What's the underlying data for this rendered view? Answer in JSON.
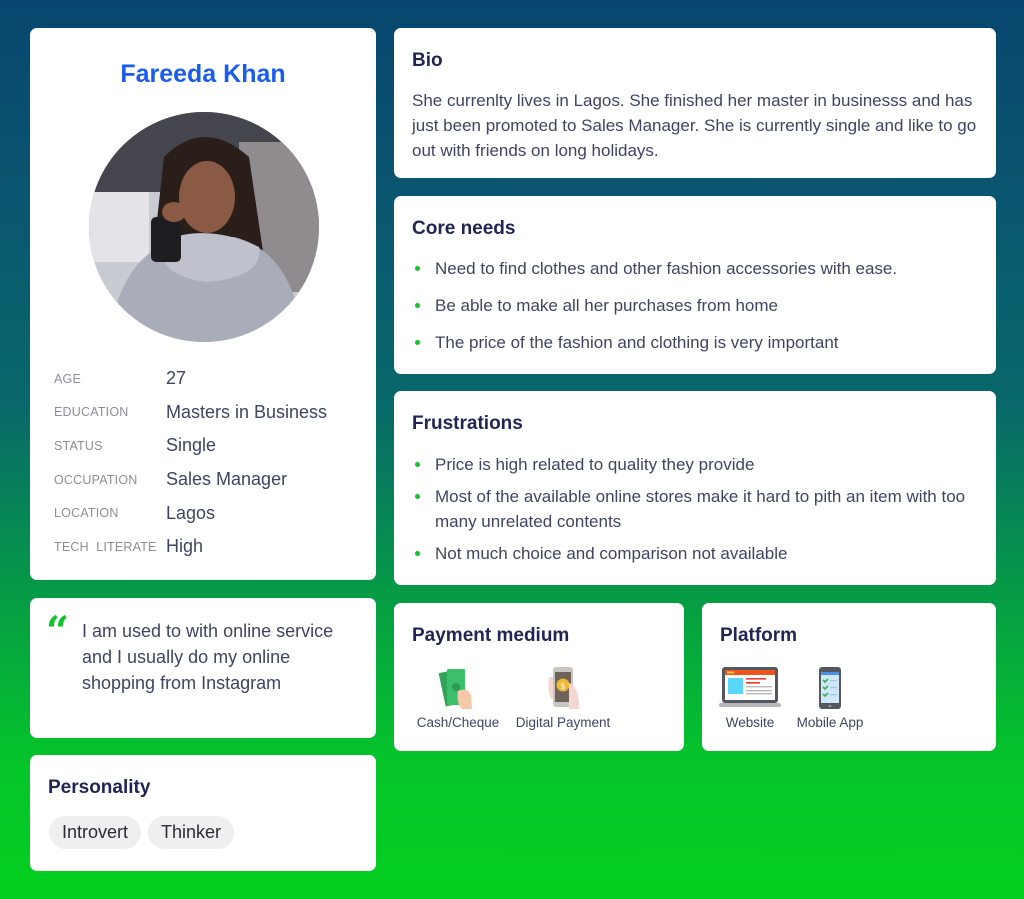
{
  "profile": {
    "name": "Fareeda Khan",
    "photo_alt": "Portrait of Fareeda Khan",
    "details": [
      {
        "label": "AGE",
        "value": "27"
      },
      {
        "label": "EDUCATION",
        "value": "Masters in Business"
      },
      {
        "label": "STATUS",
        "value": "Single"
      },
      {
        "label": "OCCUPATION",
        "value": "Sales Manager"
      },
      {
        "label": "LOCATION",
        "value": "Lagos"
      },
      {
        "label": "TECH  LITERATE",
        "value": "High"
      }
    ]
  },
  "quote": {
    "icon": "quote-icon",
    "text": "I am used to with online service and I usually do my online shopping from Instagram"
  },
  "personality": {
    "title": "Personality",
    "traits": [
      "Introvert",
      "Thinker"
    ]
  },
  "bio": {
    "title": "Bio",
    "text": "She currenlty lives in Lagos. She finished her master in businesss and has just been promoted to Sales Manager. She is currently single and like to go out with friends on long holidays."
  },
  "core_needs": {
    "title": "Core needs",
    "items": [
      "Need to find clothes and other fashion accessories with ease.",
      "Be able to make all her purchases from home",
      "The price of the fashion and clothing is very important"
    ]
  },
  "frustrations": {
    "title": "Frustrations",
    "items": [
      "Price is high related to quality they provide",
      "Most of the available online stores make it hard to pith an item with too many unrelated contents",
      "Not much choice and comparison not available"
    ]
  },
  "payment": {
    "title": "Payment medium",
    "options": [
      {
        "icon": "cash-icon",
        "label": "Cash/Cheque"
      },
      {
        "icon": "digital-payment-icon",
        "label": "Digital Payment"
      }
    ]
  },
  "platform": {
    "title": "Platform",
    "options": [
      {
        "icon": "website-icon",
        "label": "Website"
      },
      {
        "icon": "mobile-app-icon",
        "label": "Mobile App"
      }
    ]
  },
  "colors": {
    "accent_blue": "#1a5bf0",
    "accent_green": "#11c42d",
    "heading": "#1f2555",
    "bg_top": "#08466f",
    "bg_bottom": "#03cf1f"
  }
}
